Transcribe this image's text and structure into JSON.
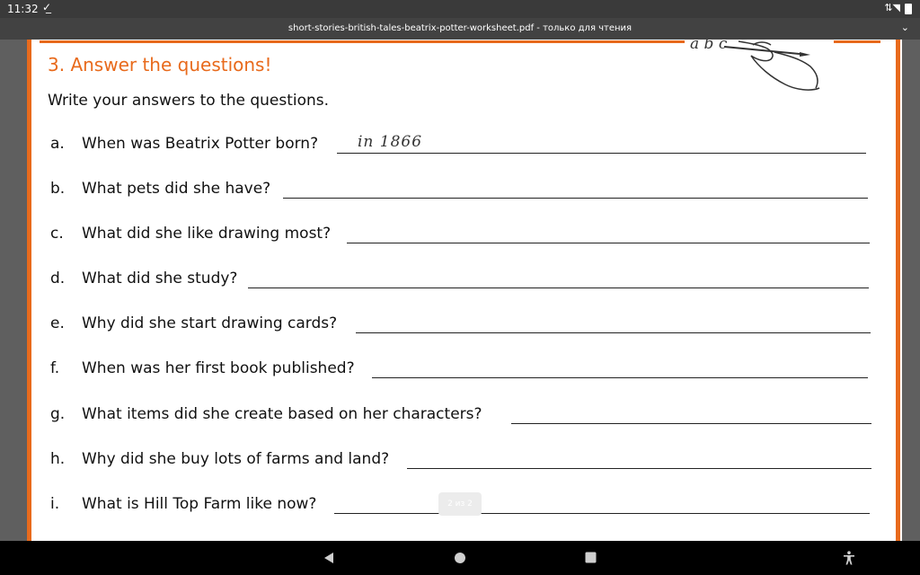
{
  "status": {
    "time": "11:32",
    "download_icon": "download-done-icon",
    "wifi_icon": "wifi-icon",
    "battery_icon": "battery-icon"
  },
  "titlebar": {
    "title": "short-stories-british-tales-beatrix-potter-worksheet.pdf - только для чтения",
    "expand_icon": "chevron-down-icon"
  },
  "worksheet": {
    "section_title": "3. Answer the questions!",
    "instruction": "Write your answers to the questions.",
    "illustration_text": "a b c",
    "questions": [
      {
        "letter": "a.",
        "text": "When was Beatrix Potter born?",
        "answer": "in 1866"
      },
      {
        "letter": "b.",
        "text": "What pets did she have?",
        "answer": ""
      },
      {
        "letter": "c.",
        "text": "What did she like drawing most?",
        "answer": ""
      },
      {
        "letter": "d.",
        "text": "What did she study?",
        "answer": ""
      },
      {
        "letter": "e.",
        "text": "Why did she start drawing cards?",
        "answer": ""
      },
      {
        "letter": "f.",
        "text": "When was her first book published?",
        "answer": ""
      },
      {
        "letter": "g.",
        "text": "What items did she create based on her characters?",
        "answer": ""
      },
      {
        "letter": "h.",
        "text": "Why did she buy lots of farms and land?",
        "answer": ""
      },
      {
        "letter": "i.",
        "text": "What is Hill Top Farm like now?",
        "answer": ""
      }
    ],
    "page_indicator": "2 из 2"
  },
  "navigation": {
    "back_icon": "back-triangle-icon",
    "home_icon": "home-circle-icon",
    "recents_icon": "recents-square-icon",
    "accessibility_icon": "accessibility-icon"
  },
  "colors": {
    "accent": "#e86a1c",
    "status_bar": "#3a3a3a",
    "title_bar": "#424242",
    "nav_bar": "#000000"
  }
}
